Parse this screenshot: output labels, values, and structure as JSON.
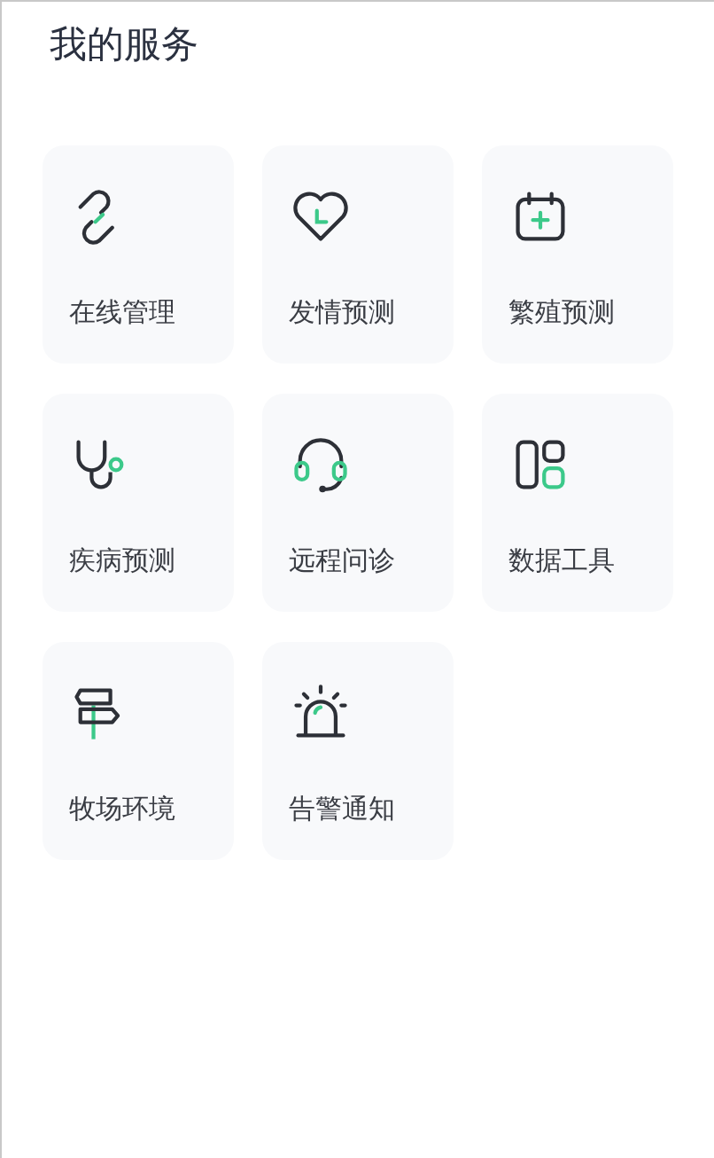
{
  "title": "我的服务",
  "services": [
    {
      "label": "在线管理"
    },
    {
      "label": "发情预测"
    },
    {
      "label": "繁殖预测"
    },
    {
      "label": "疾病预测"
    },
    {
      "label": "远程问诊"
    },
    {
      "label": "数据工具"
    },
    {
      "label": "牧场环境"
    },
    {
      "label": "告警通知"
    }
  ]
}
